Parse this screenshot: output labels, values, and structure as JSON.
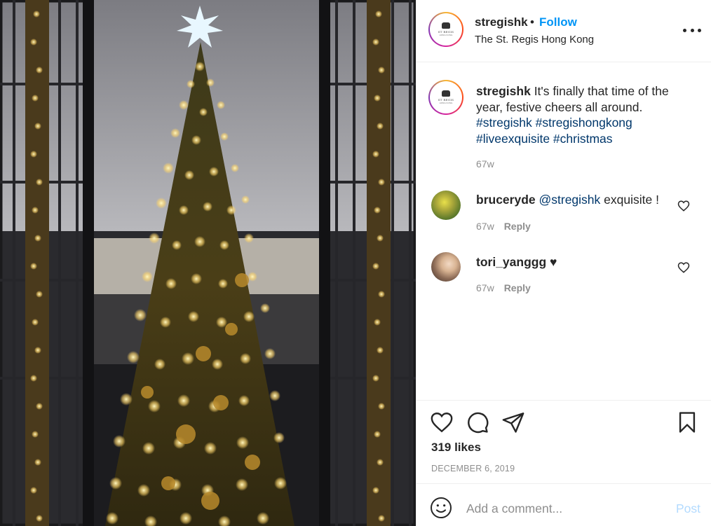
{
  "post": {
    "username": "stregishk",
    "dot": "•",
    "follow_label": "Follow",
    "location": "The St. Regis Hong Kong",
    "logo_text": "ST REGIS",
    "logo_subtext": "HONG KONG"
  },
  "caption": {
    "username": "stregishk",
    "text": "It's finally that time of the year, festive cheers all around.",
    "hashtags": "#stregishk #stregishongkong #liveexquisite #christmas",
    "time": "67w"
  },
  "comments": [
    {
      "username": "bruceryde",
      "mention": "@stregishk",
      "text": "exquisite !",
      "time": "67w",
      "reply_label": "Reply"
    },
    {
      "username": "tori_yanggg",
      "mention": "",
      "text": "♥",
      "time": "67w",
      "reply_label": "Reply"
    }
  ],
  "footer": {
    "likes": "319 likes",
    "date": "DECEMBER 6, 2019",
    "comment_placeholder": "Add a comment...",
    "post_label": "Post"
  },
  "icons": {
    "more": "more-options-icon",
    "like": "heart-icon",
    "comment": "comment-bubble-icon",
    "share": "paper-plane-icon",
    "save": "bookmark-icon",
    "emoji": "emoji-icon"
  },
  "colors": {
    "accent": "#0095f6",
    "hashtag": "#00376b",
    "muted": "#8e8e8e",
    "post_disabled": "#b3dbff"
  }
}
